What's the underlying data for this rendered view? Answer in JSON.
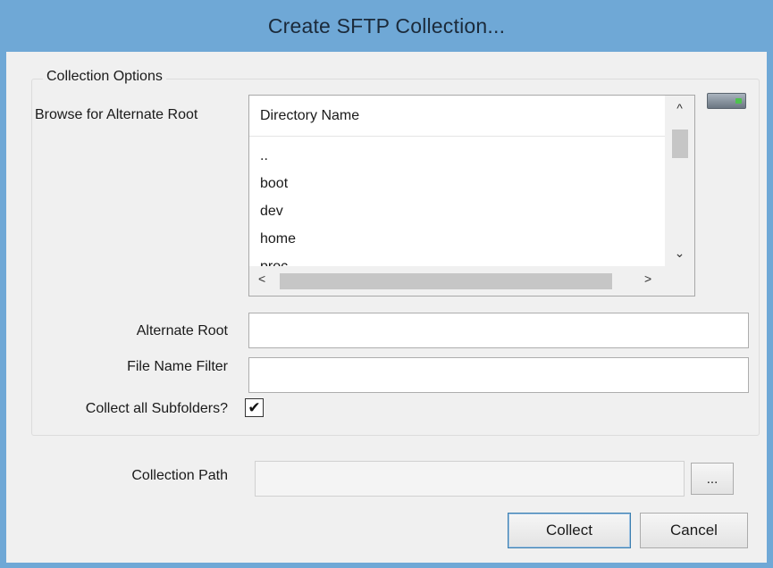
{
  "window": {
    "title": "Create SFTP Collection..."
  },
  "options": {
    "legend": "Collection Options",
    "browse_label": "Browse for Alternate Root",
    "directory": {
      "header": "Directory Name",
      "items": [
        "..",
        "boot",
        "dev",
        "home",
        "proc"
      ]
    },
    "alternate_root": {
      "label": "Alternate Root",
      "value": ""
    },
    "file_name_filter": {
      "label": "File Name Filter",
      "value": ""
    },
    "collect_subfolders": {
      "label": "Collect all Subfolders?",
      "checked": true,
      "mark": "✔"
    }
  },
  "collection_path": {
    "label": "Collection Path",
    "value": "",
    "browse_label": "..."
  },
  "buttons": {
    "collect": "Collect",
    "cancel": "Cancel"
  },
  "scroll_glyphs": {
    "up": "^",
    "down": "⌄",
    "left": "<",
    "right": ">"
  },
  "colors": {
    "titlebar": "#6fa8d6",
    "dialog_bg": "#f0f0f0",
    "default_button_border": "#3c7fb1"
  }
}
